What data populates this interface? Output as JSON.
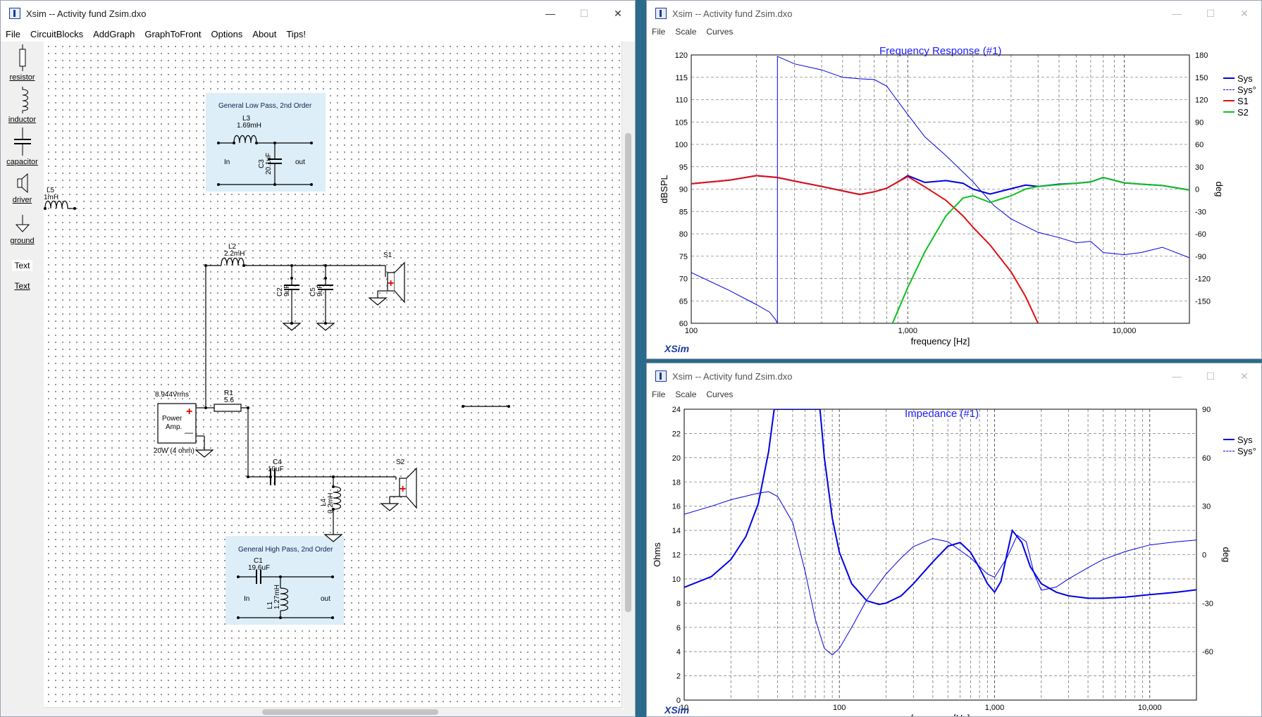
{
  "circuit_window": {
    "title": "Xsim -- Activity fund Zsim.dxo",
    "menu": [
      "File",
      "CircuitBlocks",
      "AddGraph",
      "GraphToFront",
      "Options",
      "About",
      "Tips!"
    ],
    "toolbox": [
      {
        "label": "resistor",
        "icon": "resistor-icon"
      },
      {
        "label": "inductor",
        "icon": "inductor-icon"
      },
      {
        "label": "capacitor",
        "icon": "capacitor-icon"
      },
      {
        "label": "driver",
        "icon": "driver-icon"
      },
      {
        "label": "ground",
        "icon": "ground-icon"
      },
      {
        "label": "Text",
        "icon": "text-icon"
      },
      {
        "label": "Text",
        "icon": "text-icon"
      }
    ],
    "blocks": {
      "lowpass": {
        "caption": "General Low Pass, 2nd Order",
        "l_name": "L3",
        "l_value": "1.69mH",
        "c_name": "C3",
        "c_value": "20.1uF",
        "in": "In",
        "out": "out"
      },
      "highpass": {
        "caption": "General High Pass, 2nd Order",
        "c_name": "C1",
        "c_value": "19.6uF",
        "l_name": "L1",
        "l_value": "1.27mH",
        "in": "In",
        "out": "out"
      },
      "l5": {
        "name": "L5",
        "value": "1mH"
      },
      "l2": {
        "name": "L2",
        "value": "2.2mH"
      },
      "c2": {
        "name": "C2",
        "value": "9uF"
      },
      "c5": {
        "name": "C5",
        "value": "9uF"
      },
      "s1": {
        "name": "S1"
      },
      "amp": {
        "voltage": "8.944Vrms",
        "label1": "Power",
        "label2": "Amp.",
        "rating": "20W (4 ohm)"
      },
      "r1": {
        "name": "R1",
        "value": "5.6"
      },
      "c4": {
        "name": "C4",
        "value": "10uF"
      },
      "l4": {
        "name": "L4",
        "value": "0.2mH"
      },
      "s2": {
        "name": "S2"
      }
    }
  },
  "freq_window": {
    "title": "Xsim -- Activity fund Zsim.dxo",
    "menu": [
      "File",
      "Scale",
      "Curves"
    ],
    "logo": "XSim"
  },
  "imp_window": {
    "title": "Xsim -- Activity fund Zsim.dxo",
    "menu": [
      "File",
      "Scale",
      "Curves"
    ],
    "logo": "XSim"
  },
  "colors": {
    "blue": "#0000e0",
    "red": "#e01010",
    "green": "#10c020",
    "title_blue": "#1a1aff"
  },
  "chart_data": [
    {
      "type": "line",
      "title": "Frequency Response (#1)",
      "xlabel": "frequency [Hz]",
      "ylabel": "dBSPL",
      "y2label": "deg",
      "xscale": "log",
      "xlim": [
        100,
        20000
      ],
      "ylim": [
        60,
        120
      ],
      "y2lim": [
        -180,
        180
      ],
      "xticks": [
        "100",
        "1,000",
        "10,000"
      ],
      "yticks": [
        "60",
        "65",
        "70",
        "75",
        "80",
        "85",
        "90",
        "95",
        "100",
        "105",
        "110",
        "115",
        "120"
      ],
      "y2ticks": [
        "180",
        "150",
        "120",
        "90",
        "60",
        "30",
        "0",
        "-30",
        "-60",
        "-90",
        "-120",
        "-150"
      ],
      "legend": "top-right",
      "series": [
        {
          "name": "Sys",
          "style": "solid",
          "color": "#0000e0",
          "axis": "left",
          "x": [
            100,
            150,
            200,
            250,
            300,
            400,
            500,
            600,
            700,
            800,
            900,
            1000,
            1200,
            1500,
            1800,
            2000,
            2400,
            3000,
            3500,
            4000,
            5000,
            6000,
            7000,
            8000,
            10000,
            12000,
            15000,
            20000
          ],
          "y": [
            91.2,
            92.0,
            93.0,
            92.6,
            91.8,
            90.6,
            89.6,
            88.8,
            89.4,
            90.2,
            91.6,
            93.0,
            91.5,
            91.9,
            91.3,
            90.0,
            88.9,
            90.1,
            90.9,
            90.6,
            91.1,
            91.3,
            91.6,
            92.6,
            91.4,
            91.1,
            90.8,
            89.8
          ]
        },
        {
          "name": "Sys°",
          "style": "dashed",
          "color": "#0000e0",
          "axis": "right",
          "x": [
            100,
            150,
            200,
            230,
            245,
            250,
            300,
            400,
            500,
            600,
            700,
            800,
            1000,
            1200,
            1500,
            2000,
            2500,
            3000,
            4000,
            5000,
            6000,
            7000,
            8000,
            10000,
            12000,
            15000,
            20000
          ],
          "y": [
            -112,
            -136,
            -155,
            -165,
            -175,
            178,
            168,
            160,
            150,
            148,
            147,
            138,
            100,
            70,
            45,
            10,
            -22,
            -40,
            -58,
            -65,
            -72,
            -70,
            -85,
            -88,
            -85,
            -78,
            -92
          ]
        },
        {
          "name": "S1",
          "style": "solid",
          "color": "#e01010",
          "axis": "left",
          "x": [
            100,
            150,
            200,
            250,
            300,
            400,
            500,
            600,
            700,
            800,
            900,
            1000,
            1200,
            1500,
            1800,
            2000,
            2400,
            3000,
            3500,
            4000
          ],
          "y": [
            91.2,
            92.0,
            93.0,
            92.6,
            91.8,
            90.6,
            89.6,
            88.8,
            89.4,
            90.2,
            91.6,
            92.8,
            90.5,
            87.5,
            84.0,
            81.5,
            77.5,
            71.5,
            66.0,
            60.0
          ]
        },
        {
          "name": "S2",
          "style": "solid",
          "color": "#10c020",
          "axis": "left",
          "x": [
            850,
            1000,
            1200,
            1500,
            1800,
            2000,
            2400,
            3000,
            3500,
            4000,
            5000,
            6000,
            7000,
            8000,
            10000,
            12000,
            15000,
            20000
          ],
          "y": [
            60.0,
            68.0,
            76.0,
            84.0,
            88.0,
            88.5,
            87.0,
            88.5,
            90.0,
            90.6,
            91.0,
            91.3,
            91.6,
            92.6,
            91.4,
            91.1,
            90.8,
            89.8
          ]
        }
      ]
    },
    {
      "type": "line",
      "title": "Impedance (#1)",
      "xlabel": "frequency [Hz]",
      "ylabel": "Ohms",
      "y2label": "deg",
      "xscale": "log",
      "xlim": [
        10,
        20000
      ],
      "ylim": [
        0,
        24
      ],
      "y2lim": [
        -90,
        90
      ],
      "xticks": [
        "10",
        "100",
        "1,000",
        "10,000"
      ],
      "yticks": [
        "0",
        "2",
        "4",
        "6",
        "8",
        "10",
        "12",
        "14",
        "16",
        "18",
        "20",
        "22",
        "24"
      ],
      "y2ticks": [
        "90",
        "60",
        "30",
        "0",
        "-30",
        "-60"
      ],
      "legend": "top-right",
      "series": [
        {
          "name": "Sys",
          "style": "solid",
          "color": "#0000e0",
          "axis": "left",
          "x": [
            10,
            15,
            20,
            25,
            30,
            35,
            38,
            40,
            75,
            80,
            90,
            100,
            120,
            150,
            180,
            200,
            250,
            300,
            400,
            500,
            600,
            700,
            800,
            900,
            1000,
            1100,
            1200,
            1300,
            1500,
            1700,
            2000,
            2500,
            3000,
            4000,
            5000,
            7000,
            10000,
            15000,
            20000
          ],
          "y": [
            9.3,
            10.2,
            11.6,
            13.5,
            16.2,
            20.5,
            24.0,
            24.0,
            24.0,
            20.0,
            15.0,
            12.2,
            9.6,
            8.2,
            7.9,
            8.0,
            8.6,
            9.6,
            11.4,
            12.7,
            13.0,
            12.2,
            10.9,
            9.6,
            8.9,
            9.8,
            12.0,
            14.0,
            13.0,
            11.0,
            9.6,
            8.9,
            8.6,
            8.4,
            8.4,
            8.5,
            8.7,
            8.9,
            9.1
          ]
        },
        {
          "name": "Sys°",
          "style": "dashed",
          "color": "#0000e0",
          "axis": "right",
          "x": [
            10,
            15,
            20,
            30,
            35,
            40,
            50,
            60,
            70,
            80,
            90,
            100,
            120,
            150,
            200,
            250,
            300,
            400,
            500,
            700,
            900,
            1000,
            1200,
            1400,
            1600,
            1800,
            2000,
            2500,
            3000,
            4000,
            5000,
            7000,
            10000,
            15000,
            20000
          ],
          "y": [
            25,
            30,
            34,
            38,
            39,
            36,
            20,
            -10,
            -40,
            -58,
            -62,
            -58,
            -45,
            -28,
            -12,
            -2,
            5,
            10,
            8,
            -2,
            -12,
            -14,
            -2,
            12,
            8,
            -12,
            -22,
            -20,
            -15,
            -8,
            -3,
            2,
            6,
            8,
            9
          ]
        }
      ]
    }
  ]
}
